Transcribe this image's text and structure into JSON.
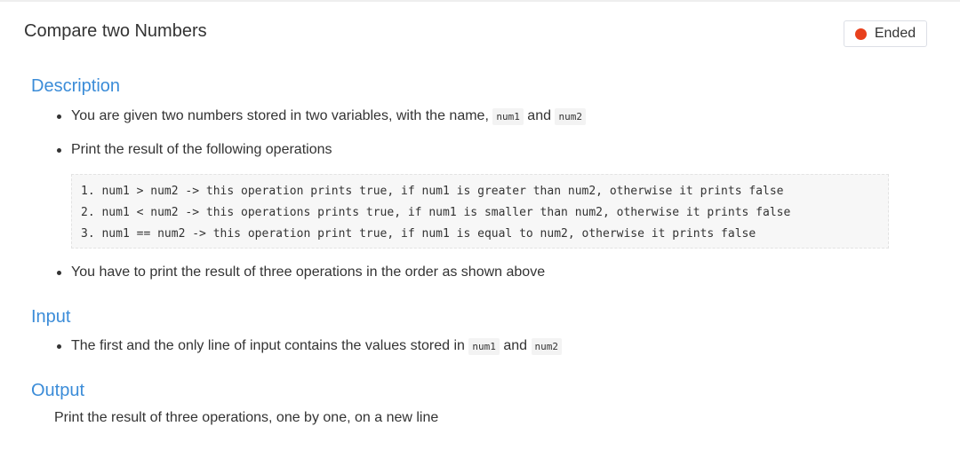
{
  "header": {
    "title": "Compare two Numbers",
    "status_label": "Ended",
    "status_color": "#e8401c"
  },
  "description": {
    "heading": "Description",
    "bullet1_prefix": "You are given two numbers stored in two variables, with the name,",
    "bullet1_code1": "num1",
    "bullet1_and": "and",
    "bullet1_code2": "num2",
    "bullet2": "Print the result of the following operations",
    "code_lines": [
      "1. num1 > num2 -> this operation prints true, if num1 is greater than num2, otherwise it prints false",
      "2. num1 < num2 -> this operations prints true, if num1 is smaller than num2, otherwise it prints false",
      "3. num1 == num2 -> this operation print true, if num1 is equal to num2, otherwise it prints false"
    ],
    "bullet3": "You have to print the result of three operations in the order as shown above"
  },
  "input": {
    "heading": "Input",
    "bullet_prefix": "The first and the only line of input contains the values stored in",
    "code1": "num1",
    "and": "and",
    "code2": "num2"
  },
  "output": {
    "heading": "Output",
    "text": "Print the result of three operations, one by one, on a new line"
  }
}
